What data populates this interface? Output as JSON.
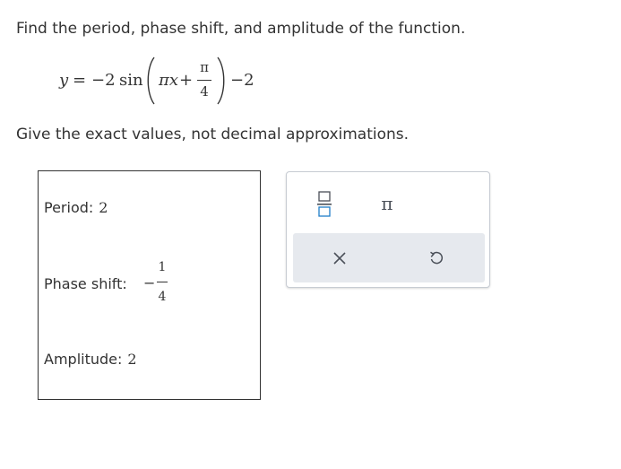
{
  "prompt": "Find the period, phase shift, and amplitude of the function.",
  "equation": {
    "lhs": "y",
    "equals": "=",
    "coefficient": "−2",
    "func": "sin",
    "inner_var": "πx",
    "plus": "+",
    "frac_num": "π",
    "frac_den": "4",
    "trailing": "−2"
  },
  "instruction": "Give the exact values, not decimal approximations.",
  "answers": {
    "period_label": "Period:",
    "period_value": "2",
    "phase_label": "Phase shift:",
    "phase_sign": "−",
    "phase_num": "1",
    "phase_den": "4",
    "amplitude_label": "Amplitude:",
    "amplitude_value": "2"
  },
  "keypad": {
    "fraction_icon": "fraction-icon",
    "pi_label": "π",
    "clear_icon": "close-icon",
    "undo_icon": "undo-icon"
  },
  "colors": {
    "text": "#333333",
    "panel_border": "#c7ccd3",
    "action_bar": "#e6e9ee",
    "accent": "#1f7ec8"
  }
}
